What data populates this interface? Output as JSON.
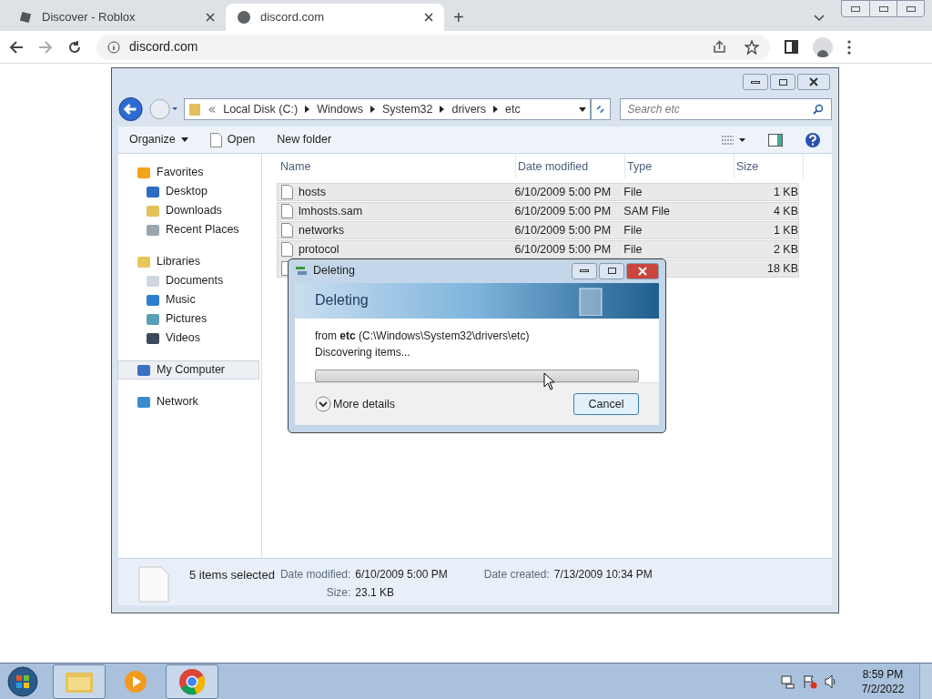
{
  "browser": {
    "tabs": [
      {
        "title": "Discover - Roblox",
        "selected": false
      },
      {
        "title": "discord.com",
        "selected": true
      }
    ],
    "new_tab": "+",
    "address": "discord.com"
  },
  "explorer": {
    "breadcrumb": [
      "Local Disk (C:)",
      "Windows",
      "System32",
      "drivers",
      "etc"
    ],
    "search": {
      "placeholder": "Search etc"
    },
    "toolbar": [
      "Organize",
      "Open",
      "New folder"
    ],
    "sidebar": [
      {
        "label": "Favorites",
        "children": [
          {
            "label": "Desktop",
            "selected": false
          },
          {
            "label": "Downloads",
            "selected": false
          },
          {
            "label": "Recent Places",
            "selected": false
          }
        ],
        "selected": false
      },
      {
        "label": "Libraries",
        "children": [
          {
            "label": "Documents",
            "selected": false
          },
          {
            "label": "Music",
            "selected": false
          },
          {
            "label": "Pictures",
            "selected": false
          },
          {
            "label": "Videos",
            "selected": false
          }
        ],
        "selected": false
      },
      {
        "label": "My Computer",
        "selected": true
      },
      {
        "label": "Network",
        "selected": false
      }
    ],
    "columns": [
      "Name",
      "Date modified",
      "Type",
      "Size"
    ],
    "rows": [
      {
        "name": "hosts",
        "modified": "6/10/2009 5:00 PM",
        "type": "File",
        "size": "1 KB",
        "selected": true
      },
      {
        "name": "lmhosts.sam",
        "modified": "6/10/2009 5:00 PM",
        "type": "SAM File",
        "size": "4 KB",
        "selected": true
      },
      {
        "name": "networks",
        "modified": "6/10/2009 5:00 PM",
        "type": "File",
        "size": "1 KB",
        "selected": true
      },
      {
        "name": "protocol",
        "modified": "6/10/2009 5:00 PM",
        "type": "File",
        "size": "2 KB",
        "selected": true
      },
      {
        "size": "18 KB",
        "selected": true
      }
    ],
    "details": {
      "summary": "5 items selected",
      "fields": [
        {
          "label": "Date modified:",
          "value": "6/10/2009 5:00 PM"
        },
        {
          "label": "Date created:",
          "value": "7/13/2009 10:34 PM"
        },
        {
          "label": "Size:",
          "value": "23.1 KB"
        }
      ]
    }
  },
  "dialog": {
    "title": "Deleting",
    "heading": "Deleting",
    "from": "from **etc** (C:\\Windows\\System32\\drivers\\etc)",
    "status": "Discovering items...",
    "progress": {
      "level": 0
    },
    "more": "More details",
    "cancel": "Cancel"
  },
  "taskbar": {
    "apps": [
      {
        "kind": "explorer",
        "selected": true
      },
      {
        "kind": "media",
        "selected": false
      },
      {
        "kind": "chrome",
        "selected": true
      }
    ],
    "time": "8:59 PM",
    "date": "7/2/2022"
  }
}
